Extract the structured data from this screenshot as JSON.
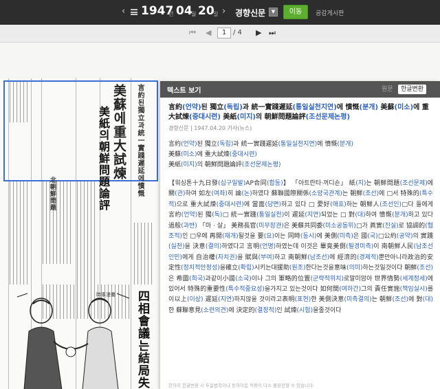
{
  "topbar": {
    "prev_arrow": "‹",
    "next_arrow": "›",
    "year": "1947",
    "year_unit": "년",
    "month": "04",
    "month_unit": "월",
    "day": "20",
    "day_unit": "일",
    "newspaper": "경향신문",
    "go_button": "이동",
    "board_link": "공감게시판"
  },
  "pager": {
    "first": "⏮",
    "prev": "◀",
    "current_page": "1",
    "total": "/ 4",
    "next": "▶",
    "last": "⏭"
  },
  "paper_image": {
    "headline_1": "美蘇에重大試煉",
    "headline_2": "美紙의朝鮮問題論評",
    "side_heading": "言約된獨立과統一實踐遲延에憤慨",
    "lower_heading_1": "四相會議는結局失",
    "lower_heading_2": "北朝鮮問題",
    "cartoon_caption": "時事漫畵"
  },
  "panel": {
    "title": "텍스트 보기",
    "tab_original": "원문",
    "tab_korean": "한글변환",
    "headline_segments": [
      {
        "t": "言約",
        "k": false
      },
      {
        "t": "(언약)",
        "k": true
      },
      {
        "t": "된 獨立",
        "k": false
      },
      {
        "t": "(독립)",
        "k": true
      },
      {
        "t": "과 統一實踐遲延",
        "k": false
      },
      {
        "t": "(통일실천지연)",
        "k": true
      },
      {
        "t": "에 憤慨",
        "k": false
      },
      {
        "t": "(분개)",
        "k": true
      },
      {
        "t": " 美蘇",
        "k": false
      },
      {
        "t": "(미소)",
        "k": true
      },
      {
        "t": "에 重大試煉",
        "k": false
      },
      {
        "t": "(중대시련)",
        "k": true
      },
      {
        "t": " 美紙",
        "k": false
      },
      {
        "t": "(미지)",
        "k": true
      },
      {
        "t": "의 朝鮮問題論評",
        "k": false
      },
      {
        "t": "(조선문제논평)",
        "k": true
      }
    ],
    "meta": "경향신문 | 1947.04.20 기사(뉴스)",
    "sub_lines": [
      [
        {
          "t": "言約",
          "k": false
        },
        {
          "t": "(언약)",
          "k": true
        },
        {
          "t": "된 獨立",
          "k": false
        },
        {
          "t": "(독립)",
          "k": true
        },
        {
          "t": "과 統一實踐遲延",
          "k": false
        },
        {
          "t": "(통일실천지연)",
          "k": true
        },
        {
          "t": "에 憤慨",
          "k": false
        },
        {
          "t": "(분개)",
          "k": true
        }
      ],
      [
        {
          "t": "美蘇",
          "k": false
        },
        {
          "t": "(미소)",
          "k": true
        },
        {
          "t": "에 重大試煉",
          "k": false
        },
        {
          "t": "(중대시련)",
          "k": true
        }
      ],
      [
        {
          "t": "美紙",
          "k": false
        },
        {
          "t": "(미지)",
          "k": true
        },
        {
          "t": "의 朝鮮問題論評",
          "k": false
        },
        {
          "t": "(조선문제논평)",
          "k": true
        }
      ]
    ],
    "body_segments": [
      {
        "t": "【워싱톤十九日發",
        "k": false
      },
      {
        "t": "(십구일발)",
        "k": true
      },
      {
        "t": "AP合同",
        "k": false
      },
      {
        "t": "(합동)",
        "k": true
      },
      {
        "t": "】 「아트란타‧꺼디숀」 紙",
        "k": false
      },
      {
        "t": "(지)",
        "k": true
      },
      {
        "t": "는 朝鮮問題",
        "k": false
      },
      {
        "t": "(조선문제)",
        "k": true
      },
      {
        "t": "에 關",
        "k": false
      },
      {
        "t": "(관)",
        "k": true
      },
      {
        "t": "하여 如左",
        "k": false
      },
      {
        "t": "(여좌)",
        "k": true
      },
      {
        "t": "히 論",
        "k": false
      },
      {
        "t": "(논)",
        "k": true
      },
      {
        "t": "하였다 蘇聯國際關係",
        "k": false
      },
      {
        "t": "(소양국관계)",
        "k": true
      },
      {
        "t": "는 朝鮮",
        "k": false
      },
      {
        "t": "(조선)",
        "k": true
      },
      {
        "t": "에 □서 特殊的",
        "k": false
      },
      {
        "t": "(특수적)",
        "k": true
      },
      {
        "t": "으로 重大試煉",
        "k": false
      },
      {
        "t": "(중대시련)",
        "k": true
      },
      {
        "t": "에 當面",
        "k": false
      },
      {
        "t": "(당면)",
        "k": true
      },
      {
        "t": "하고 있다 □ 愛好",
        "k": false
      },
      {
        "t": "(애호)",
        "k": true
      },
      {
        "t": "하는 朝鮮人",
        "k": false
      },
      {
        "t": "(조선인)",
        "k": true
      },
      {
        "t": "□다 들에게 言約",
        "k": false
      },
      {
        "t": "(언약)",
        "k": true
      },
      {
        "t": "된 獨",
        "k": false
      },
      {
        "t": "(독)",
        "k": true
      },
      {
        "t": "□ 統一實踐",
        "k": false
      },
      {
        "t": "(통일실천)",
        "k": true
      },
      {
        "t": "이 遲延",
        "k": false
      },
      {
        "t": "(지연)",
        "k": true
      },
      {
        "t": "되었는 □ 對",
        "k": false
      },
      {
        "t": "(대)",
        "k": true
      },
      {
        "t": "하여 憤慨",
        "k": false
      },
      {
        "t": "(분개)",
        "k": true
      },
      {
        "t": "하고 있다 過般",
        "k": false
      },
      {
        "t": "(과반)",
        "k": true
      },
      {
        "t": " 「마 ‧ 살」 美務長官",
        "k": false
      },
      {
        "t": "(미무장관)",
        "k": true
      },
      {
        "t": "은 美蘇共同委",
        "k": false
      },
      {
        "t": "(미소공동위)",
        "k": true
      },
      {
        "t": "□가 眞實",
        "k": false
      },
      {
        "t": "(진실)",
        "k": true
      },
      {
        "t": "로 協調的",
        "k": false
      },
      {
        "t": "(협조적)",
        "k": true
      },
      {
        "t": "인 □우에 再開",
        "k": false
      },
      {
        "t": "(재개)",
        "k": true
      },
      {
        "t": "될것을 要",
        "k": false
      },
      {
        "t": "(요)",
        "k": true
      },
      {
        "t": "이는 同時",
        "k": false
      },
      {
        "t": "(동시)",
        "k": true
      },
      {
        "t": "에 美側",
        "k": false
      },
      {
        "t": "(미측)",
        "k": true
      },
      {
        "t": "은 國",
        "k": false
      },
      {
        "t": "(국)",
        "k": true
      },
      {
        "t": "□公約",
        "k": false
      },
      {
        "t": "(공약)",
        "k": true
      },
      {
        "t": "의 實踐",
        "k": false
      },
      {
        "t": "(실천)",
        "k": true
      },
      {
        "t": "을 決意",
        "k": false
      },
      {
        "t": "(결의)",
        "k": true
      },
      {
        "t": "하였다고 言明",
        "k": false
      },
      {
        "t": "(언명)",
        "k": true
      },
      {
        "t": "하였는데 이것은 畢竟美側",
        "k": false
      },
      {
        "t": "(필경미측)",
        "k": true
      },
      {
        "t": "이 南朝鮮人民",
        "k": false
      },
      {
        "t": "(남조선인민)",
        "k": true
      },
      {
        "t": "에게 自治權",
        "k": false
      },
      {
        "t": "(자치권)",
        "k": true
      },
      {
        "t": "을 賦與",
        "k": false
      },
      {
        "t": "(부여)",
        "k": true
      },
      {
        "t": "하고 南朝鮮",
        "k": false
      },
      {
        "t": "(남조선)",
        "k": true
      },
      {
        "t": "에 經濟的",
        "k": false
      },
      {
        "t": "(경제적)",
        "k": true
      },
      {
        "t": "뿐만아니라政治的安定性",
        "k": false
      },
      {
        "t": "(정치적안정성)",
        "k": true
      },
      {
        "t": "을確立",
        "k": false
      },
      {
        "t": "(확립)",
        "k": true
      },
      {
        "t": "시키는대援助",
        "k": false
      },
      {
        "t": "(원조)",
        "k": true
      },
      {
        "t": "한다는것을意味",
        "k": false
      },
      {
        "t": "(의미)",
        "k": true
      },
      {
        "t": "하는것일것이다 朝鮮",
        "k": false
      },
      {
        "t": "(조선)",
        "k": true
      },
      {
        "t": "은 希圖",
        "k": false
      },
      {
        "t": "(희국)",
        "k": true
      },
      {
        "t": "과같이小國",
        "k": false
      },
      {
        "t": "(소국)",
        "k": true
      },
      {
        "t": "이나 그의 軍略的位置",
        "k": false
      },
      {
        "t": "(군략적위치)",
        "k": true
      },
      {
        "t": "로말미암아 世界情勢",
        "k": false
      },
      {
        "t": "(세계정세)",
        "k": true
      },
      {
        "t": "에있어서 特殊的重要性",
        "k": false
      },
      {
        "t": "(특수적중요성)",
        "k": true
      },
      {
        "t": "을가지고 있는것이다 如何間",
        "k": false
      },
      {
        "t": "(여하간)",
        "k": true
      },
      {
        "t": "그의 責任實施",
        "k": false
      },
      {
        "t": "(책임실시)",
        "k": true
      },
      {
        "t": "를 이以上",
        "k": false
      },
      {
        "t": "(이상)",
        "k": true
      },
      {
        "t": " 遲延",
        "k": false
      },
      {
        "t": "(지연)",
        "k": true
      },
      {
        "t": "하지않을 것이라고表明",
        "k": false
      },
      {
        "t": "(표현)",
        "k": true
      },
      {
        "t": "한 美側決意",
        "k": false
      },
      {
        "t": "(미측결의)",
        "k": true
      },
      {
        "t": "는 朝鮮",
        "k": false
      },
      {
        "t": "(조선)",
        "k": true
      },
      {
        "t": "에 對",
        "k": false
      },
      {
        "t": "(대)",
        "k": true
      },
      {
        "t": "한 蘇聯意見",
        "k": false
      },
      {
        "t": "(소련의견)",
        "k": true
      },
      {
        "t": "에 決定的",
        "k": false
      },
      {
        "t": "(결정적)",
        "k": true
      },
      {
        "t": "인 試煉",
        "k": false
      },
      {
        "t": "(시험)",
        "k": true
      },
      {
        "t": "을줄것이다",
        "k": false
      }
    ],
    "footer_note": "한자의 한글변환 시 두음법칙이나 동자이음 적용이 다소 불완전할 수 있습니다."
  },
  "colors": {
    "topbar_bg": "#2d2d2d",
    "go_button": "#5cae2e",
    "highlight_box": "#3b6fd6",
    "hangul_reading": "#2a5fbf"
  }
}
